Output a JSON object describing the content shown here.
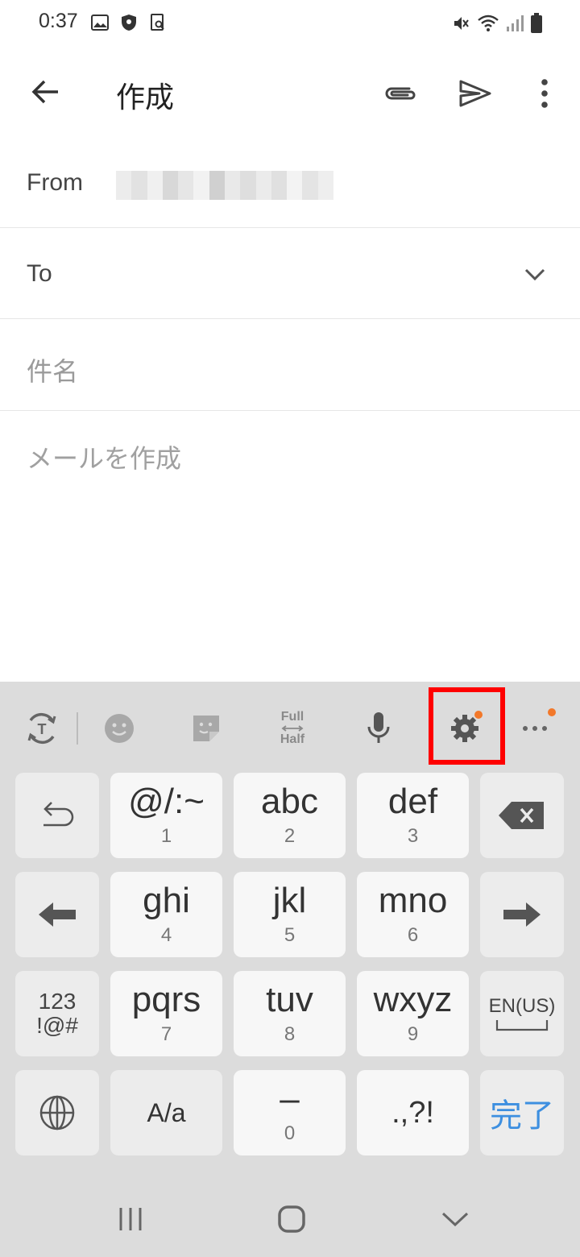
{
  "status_bar": {
    "time": "0:37",
    "left_icons": [
      "gallery-icon",
      "shield-icon",
      "search-doc-icon"
    ],
    "right_icons": [
      "mute-icon",
      "wifi-icon",
      "signal-icon",
      "battery-icon"
    ]
  },
  "app_bar": {
    "title": "作成",
    "back_icon": "arrow-back-icon",
    "actions": [
      "attach-icon",
      "send-icon",
      "more-vert-icon"
    ]
  },
  "form": {
    "from_label": "From",
    "from_value_pixelated": true,
    "to_label": "To",
    "subject_placeholder": "件名",
    "body_placeholder": "メールを作成"
  },
  "keyboard": {
    "toolbar": {
      "fullhalf_top": "Full",
      "fullhalf_bottom": "Half",
      "highlighted": "settings-icon",
      "highlight_color": "#ff0000",
      "notification_dot_color": "#f2782a"
    },
    "rows": [
      [
        {
          "main": "",
          "sub": "",
          "icon": "undo-icon"
        },
        {
          "main": "@/:~",
          "sub": "1"
        },
        {
          "main": "abc",
          "sub": "2"
        },
        {
          "main": "def",
          "sub": "3"
        },
        {
          "main": "",
          "sub": "",
          "icon": "backspace-icon"
        }
      ],
      [
        {
          "main": "",
          "sub": "",
          "icon": "arrow-left-icon"
        },
        {
          "main": "ghi",
          "sub": "4"
        },
        {
          "main": "jkl",
          "sub": "5"
        },
        {
          "main": "mno",
          "sub": "6"
        },
        {
          "main": "",
          "sub": "",
          "icon": "arrow-right-icon"
        }
      ],
      [
        {
          "main": "123",
          "sub": "!@#"
        },
        {
          "main": "pqrs",
          "sub": "7"
        },
        {
          "main": "tuv",
          "sub": "8"
        },
        {
          "main": "wxyz",
          "sub": "9"
        },
        {
          "main": "EN(US)",
          "sub": "",
          "icon": "space-icon"
        }
      ],
      [
        {
          "main": "",
          "sub": "",
          "icon": "globe-icon"
        },
        {
          "main": "A/a",
          "sub": ""
        },
        {
          "main": "–",
          "sub": "0"
        },
        {
          "main": ".,?!",
          "sub": ""
        },
        {
          "main": "完了",
          "sub": ""
        }
      ]
    ],
    "done_color": "#3d8fe0"
  },
  "nav_bar": {
    "buttons": [
      "recents-icon",
      "home-icon",
      "back-chevron-icon"
    ]
  }
}
